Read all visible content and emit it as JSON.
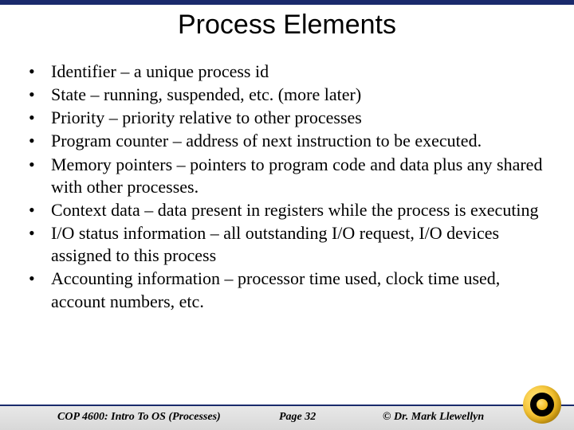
{
  "title": "Process Elements",
  "bullets": [
    "Identifier – a unique process id",
    "State – running, suspended, etc. (more later)",
    "Priority – priority relative to other processes",
    "Program counter – address of next instruction to be executed.",
    "Memory pointers – pointers to program code and data plus any shared with other processes.",
    "Context data – data present in registers while the process is executing",
    "I/O status information – all outstanding I/O request, I/O devices assigned to this process",
    "Accounting information – processor time used, clock time used, account numbers, etc."
  ],
  "footer": {
    "course": "COP 4600: Intro To OS  (Processes)",
    "page": "Page 32",
    "author": "© Dr. Mark Llewellyn"
  }
}
